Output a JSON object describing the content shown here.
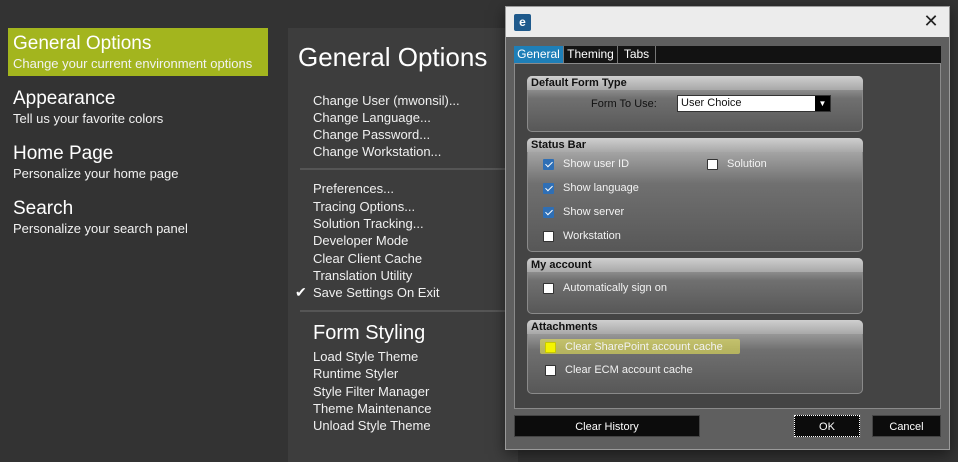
{
  "nav": {
    "items": [
      {
        "title": "General Options",
        "subtitle": "Change your current environment options"
      },
      {
        "title": "Appearance",
        "subtitle": "Tell us your favorite colors"
      },
      {
        "title": "Home Page",
        "subtitle": "Personalize your home page"
      },
      {
        "title": "Search",
        "subtitle": "Personalize your search panel"
      }
    ]
  },
  "options": {
    "title": "General Options",
    "group1": [
      "Change User (mwonsil)...",
      "Change Language...",
      "Change Password...",
      "Change Workstation..."
    ],
    "group2": [
      "Preferences...",
      "Tracing Options...",
      "Solution Tracking...",
      "Developer Mode",
      "Clear Client Cache",
      "Translation Utility",
      "Save Settings On Exit"
    ],
    "save_settings_checked": true,
    "form_styling_title": "Form Styling",
    "group3": [
      "Load Style Theme",
      "Runtime Styler",
      "Style Filter Manager",
      "Theme Maintenance",
      "Unload Style Theme"
    ]
  },
  "dialog": {
    "close_glyph": "✕",
    "app_icon_letter": "e",
    "tabs": [
      "General",
      "Theming",
      "Tabs"
    ],
    "active_tab": "General",
    "default_form_type": {
      "title": "Default Form Type",
      "label": "Form To Use:",
      "value": "User Choice"
    },
    "status_bar": {
      "title": "Status Bar",
      "show_user_id": {
        "label": "Show user ID",
        "checked": true
      },
      "solution": {
        "label": "Solution",
        "checked": false
      },
      "show_language": {
        "label": "Show language",
        "checked": true
      },
      "show_server": {
        "label": "Show server",
        "checked": true
      },
      "workstation": {
        "label": "Workstation",
        "checked": false
      }
    },
    "my_account": {
      "title": "My account",
      "auto_sign_on": {
        "label": "Automatically sign on",
        "checked": false
      }
    },
    "attachments": {
      "title": "Attachments",
      "clear_sharepoint": {
        "label": "Clear SharePoint account cache",
        "checked": false,
        "highlighted": true
      },
      "clear_ecm": {
        "label": "Clear ECM account cache",
        "checked": false
      }
    },
    "buttons": {
      "clear_history": "Clear History",
      "ok": "OK",
      "cancel": "Cancel"
    }
  },
  "colors": {
    "accent": "#a3b51e",
    "tab_active": "#1e7fb8",
    "checkbox_checked": "#2f6fb5",
    "highlight": "#f2ef55"
  }
}
